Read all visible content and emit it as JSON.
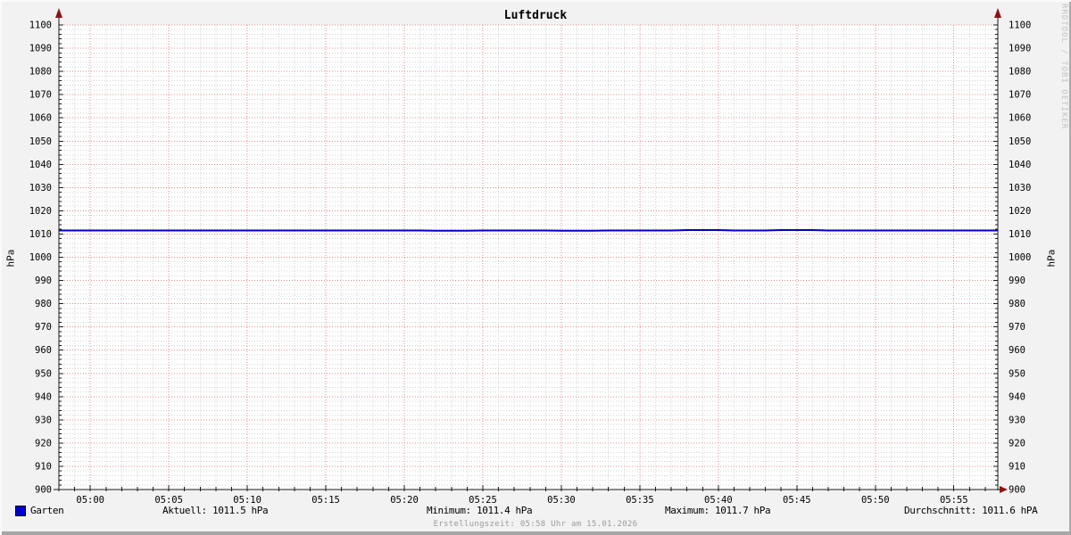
{
  "title": "Luftdruck",
  "watermark": "RRDTOOL / TOBI OETIKER",
  "axis": {
    "left_unit": "hPa",
    "right_unit": "hPa"
  },
  "legend": {
    "series_label": "Garten",
    "stats": [
      "Aktuell: 1011.5 hPa",
      "Minimum: 1011.4 hPa",
      "Maximum: 1011.7 hPa",
      "Durchschnitt: 1011.6 hPA"
    ]
  },
  "footer": "Erstellungszeit: 05:58 Uhr am 15.01.2026",
  "colors": {
    "background": "#f2f2f2",
    "canvas": "#ffffff",
    "major_grid": "#e08c8c",
    "minor_grid": "#d3d3d3",
    "axis": "#1a1a1a",
    "arrow": "#8d1414",
    "line": "#0000c8",
    "swatch": "#0000cc",
    "watermark_text": "#c3c3c3",
    "footer_text": "#9b9b9b"
  },
  "chart_data": {
    "type": "line",
    "title": "Luftdruck",
    "xlabel": "",
    "ylabel": "hPa",
    "ylim": [
      900,
      1100
    ],
    "y_tick_step": 10,
    "y_minor_step": 2,
    "x_ticks": [
      "05:00",
      "05:05",
      "05:10",
      "05:15",
      "05:20",
      "05:25",
      "05:30",
      "05:35",
      "05:40",
      "05:45",
      "05:50",
      "05:55"
    ],
    "x_tick_interval_minutes": 5,
    "x_minor_interval_minutes": 1,
    "x_range_minutes": [
      -2,
      57.8
    ],
    "grid": true,
    "legend_position": "bottom",
    "series": [
      {
        "name": "Garten",
        "color": "#0000c8",
        "unit": "hPa",
        "points": [
          [
            -2,
            1011.5
          ],
          [
            21,
            1011.5
          ],
          [
            22,
            1011.4
          ],
          [
            24,
            1011.4
          ],
          [
            25,
            1011.5
          ],
          [
            29,
            1011.5
          ],
          [
            30,
            1011.4
          ],
          [
            32,
            1011.4
          ],
          [
            33,
            1011.5
          ],
          [
            37,
            1011.5
          ],
          [
            38,
            1011.7
          ],
          [
            40,
            1011.7
          ],
          [
            41,
            1011.5
          ],
          [
            43,
            1011.5
          ],
          [
            44,
            1011.7
          ],
          [
            46,
            1011.7
          ],
          [
            47,
            1011.5
          ],
          [
            57.8,
            1011.5
          ]
        ]
      }
    ],
    "stats": {
      "aktuell": 1011.5,
      "minimum": 1011.4,
      "maximum": 1011.7,
      "durchschnitt": 1011.6
    }
  }
}
